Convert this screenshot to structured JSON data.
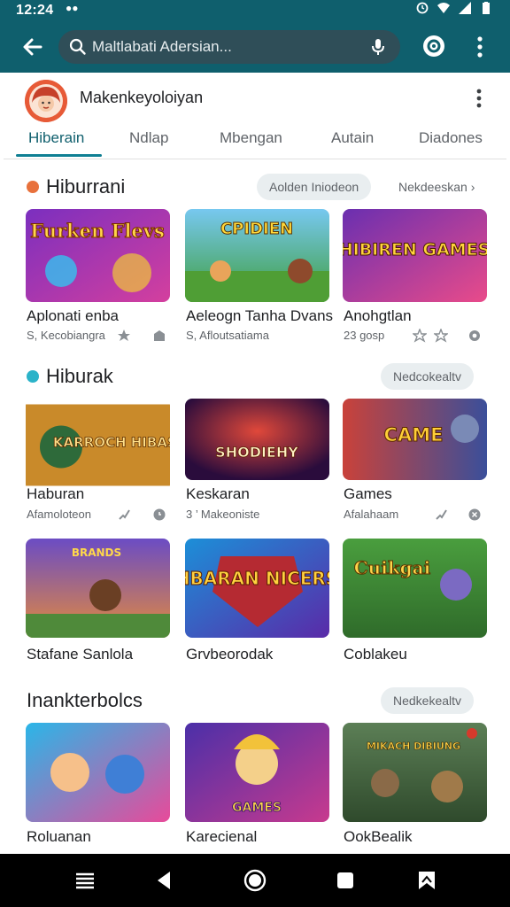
{
  "status_bar": {
    "time": "12:24",
    "extra": "●●"
  },
  "search": {
    "placeholder": "Maltlabati Adersian..."
  },
  "account": {
    "name": "Makenkeyoloiyan"
  },
  "tabs": [
    {
      "label": "Hiberain",
      "active": true
    },
    {
      "label": "Ndlap",
      "active": false
    },
    {
      "label": "Mbengan",
      "active": false
    },
    {
      "label": "Autain",
      "active": false
    },
    {
      "label": "Diadones",
      "active": false
    }
  ],
  "sections": [
    {
      "title": "Hiburrani",
      "chips": [
        "Aolden Iniodeon",
        "Nekdeeskan ›"
      ],
      "games": [
        {
          "title": "Aplonati enba",
          "meta": "S, Kecobiangra",
          "art_text": "Furken Flevs"
        },
        {
          "title": "Aeleogn Tanha Dvans",
          "meta": "S, Afloutsatiama",
          "art_text": "CPIDIEN"
        },
        {
          "title": "Anohgtlan",
          "meta": "23 gosp",
          "art_text": "HIBIREN GAMES"
        }
      ]
    },
    {
      "title": "Hiburak",
      "chips": [
        "Nedcokealtv"
      ],
      "games": [
        {
          "title": "Haburan",
          "meta": "Afamoloteon",
          "art_text": "KARROCH HIBASAS"
        },
        {
          "title": "Keskaran",
          "meta": "3 ’ Makeoniste",
          "art_text": "SHODIEHY"
        },
        {
          "title": "Games",
          "meta": "Afalahaam",
          "art_text": "CAME"
        },
        {
          "title": "Stafane Sanlola",
          "meta": "",
          "art_text": "BRANDS"
        },
        {
          "title": "Grvbeorodak",
          "meta": "",
          "art_text": "HBARAN NICERS"
        },
        {
          "title": "Coblakeu",
          "meta": "",
          "art_text": "Cuikgai"
        }
      ]
    },
    {
      "title": "Inankterbolcs",
      "chips": [
        "Nedkekealtv"
      ],
      "games": [
        {
          "title": "Roluanan",
          "meta": "",
          "art_text": ""
        },
        {
          "title": "Karecienal",
          "meta": "",
          "art_text": "GAMES"
        },
        {
          "title": "OokBealik",
          "meta": "",
          "art_text": "MIKACH DIBIUNG"
        }
      ]
    }
  ],
  "colors": {
    "appbar": "#0f5f6d",
    "accent": "#0f7f93",
    "navbar": "#000000"
  },
  "icons": [
    "back-arrow-icon",
    "search-icon",
    "mic-icon",
    "lens-icon",
    "more-vert-icon",
    "menu-icon",
    "back-triangle-icon",
    "home-circle-icon",
    "recents-square-icon",
    "assistant-icon"
  ]
}
